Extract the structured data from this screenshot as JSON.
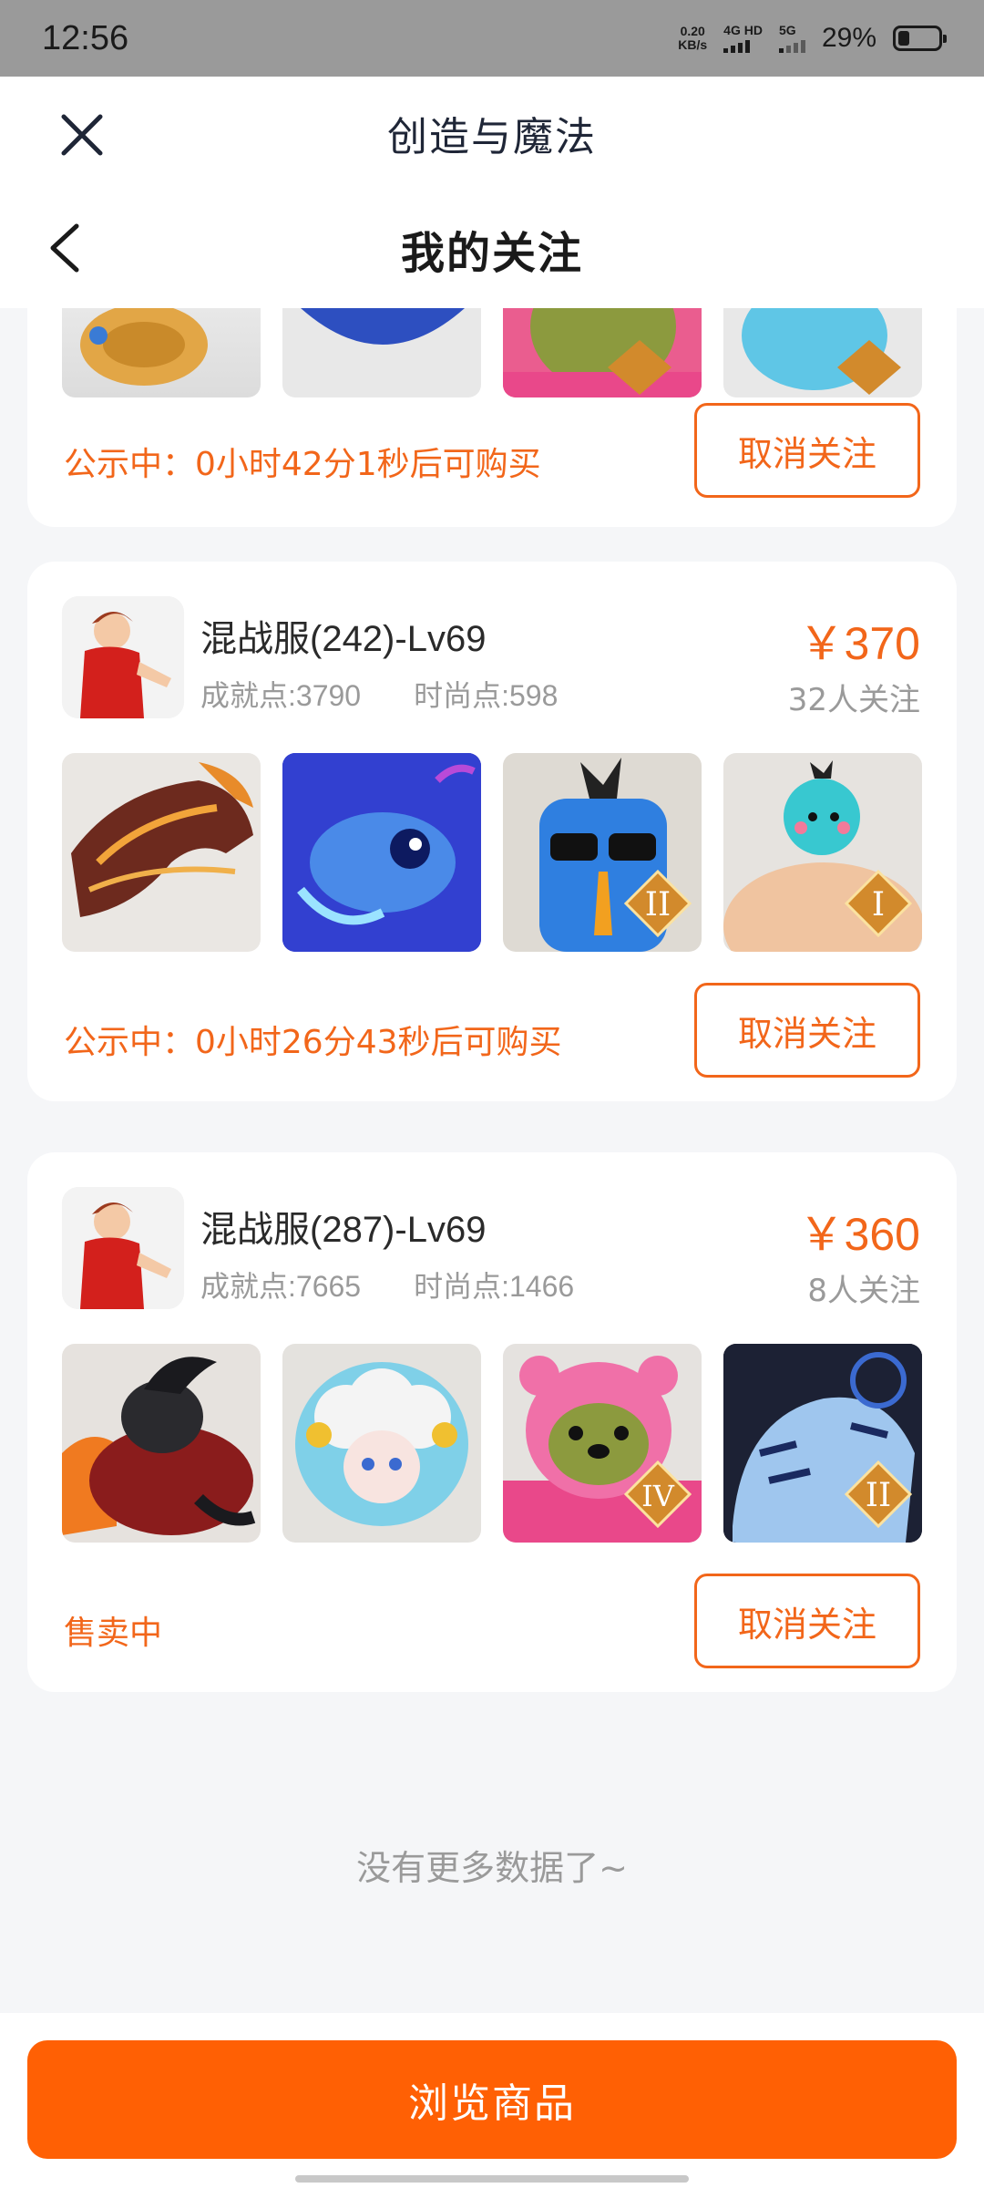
{
  "status_bar": {
    "time": "12:56",
    "net_speed_value": "0.20",
    "net_speed_unit": "KB/s",
    "network_1": "4G HD",
    "network_2": "5G",
    "battery": "29%"
  },
  "header": {
    "app_title": "创造与魔法",
    "page_title": "我的关注"
  },
  "cards": [
    {
      "status": "公示中：0小时42分1秒后可购买",
      "unfollow_label": "取消关注"
    },
    {
      "server": "混战服(242)-Lv69",
      "achievement": "成就点:3790",
      "fashion": "时尚点:598",
      "price": "￥370",
      "followers": "32人关注",
      "status": "公示中：0小时26分43秒后可购买",
      "unfollow_label": "取消关注"
    },
    {
      "server": "混战服(287)-Lv69",
      "achievement": "成就点:7665",
      "fashion": "时尚点:1466",
      "price": "￥360",
      "followers": "8人关注",
      "status": "售卖中",
      "unfollow_label": "取消关注"
    }
  ],
  "footer_note": "没有更多数据了~",
  "browse_button": "浏览商品",
  "colors": {
    "accent": "#f2661a",
    "button": "#ff6004"
  }
}
